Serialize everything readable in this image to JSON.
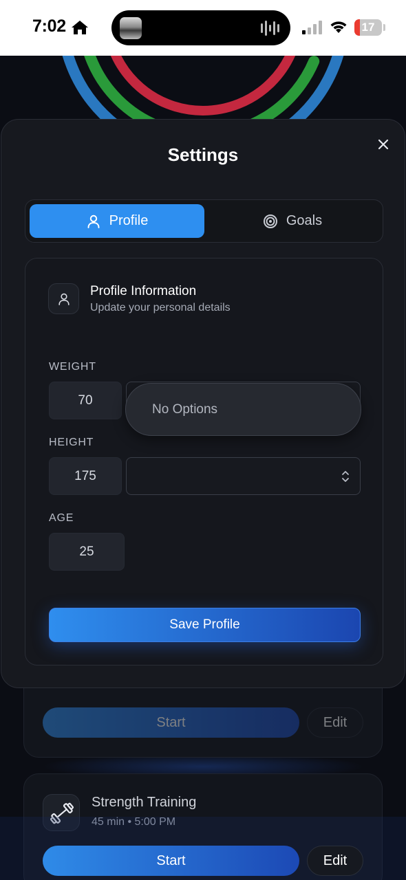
{
  "status_bar": {
    "time": "7:02",
    "battery_level": "17"
  },
  "modal": {
    "title": "Settings",
    "tabs": [
      {
        "label": "Profile",
        "icon": "user-icon",
        "active": true
      },
      {
        "label": "Goals",
        "icon": "target-icon",
        "active": false
      }
    ],
    "section": {
      "title": "Profile Information",
      "subtitle": "Update your personal details",
      "icon": "user-icon"
    },
    "fields": {
      "weight": {
        "label": "WEIGHT",
        "value": "70"
      },
      "height": {
        "label": "HEIGHT",
        "value": "175"
      },
      "age": {
        "label": "AGE",
        "value": "25"
      }
    },
    "dropdown": {
      "text": "No Options"
    },
    "save_label": "Save Profile"
  },
  "background": {
    "card1": {
      "start_label": "Start",
      "edit_label": "Edit"
    },
    "card2": {
      "title": "Strength Training",
      "meta": "45 min • 5:00 PM",
      "icon": "dumbbell-icon",
      "start_label": "Start",
      "edit_label": "Edit"
    }
  },
  "colors": {
    "accent": "#2e8ff0",
    "ring_red": "#c4283f",
    "ring_green": "#2a9a3a",
    "ring_blue": "#2a78c0"
  }
}
